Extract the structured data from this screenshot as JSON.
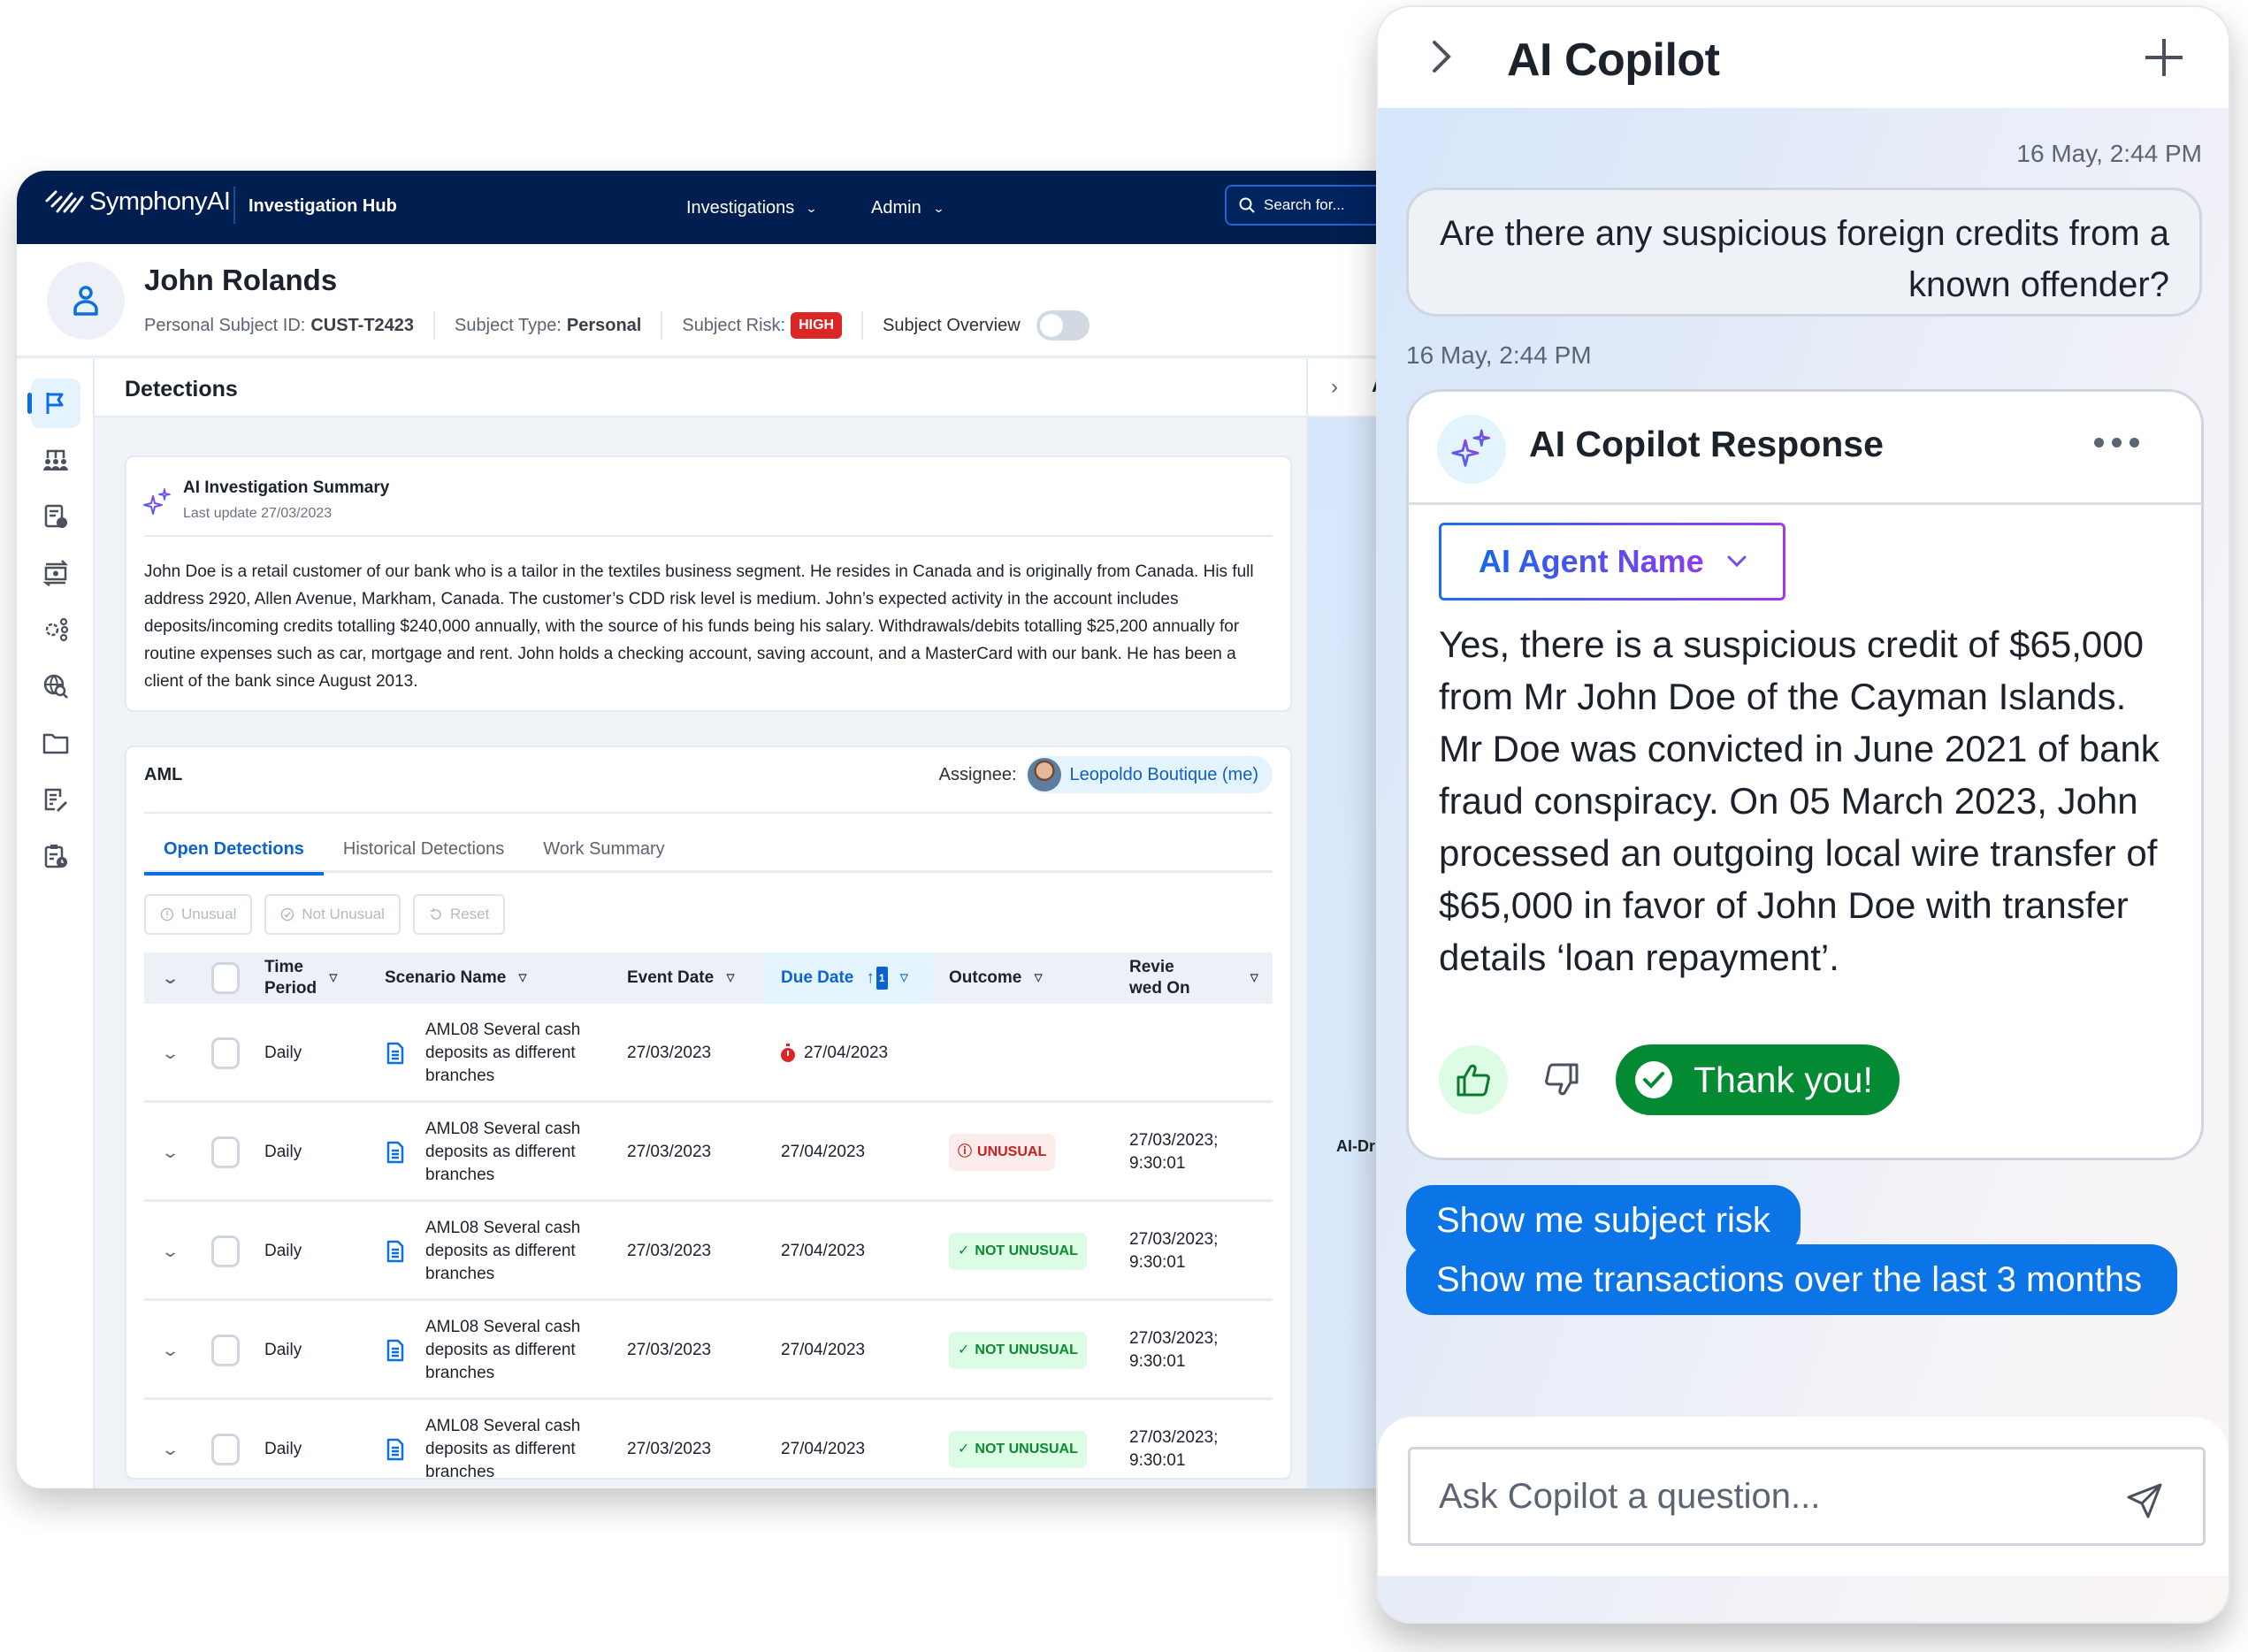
{
  "app": {
    "brand": "SymphonyAI",
    "product": "Investigation Hub",
    "nav": [
      {
        "label": "Investigations",
        "icon": "chevron-down-icon"
      },
      {
        "label": "Admin",
        "icon": "chevron-down-icon"
      }
    ],
    "search": {
      "placeholder": "Search for..."
    }
  },
  "subject": {
    "name": "John Rolands",
    "id_label": "Personal Subject ID:",
    "id_value": "CUST-T2423",
    "type_label": "Subject Type:",
    "type_value": "Personal",
    "risk_label": "Subject Risk:",
    "risk_value": "HIGH",
    "overview_label": "Subject Overview",
    "overview_on": false
  },
  "sidebar": {
    "items": [
      {
        "icon": "flag-icon",
        "active": true
      },
      {
        "icon": "org-people-icon"
      },
      {
        "icon": "document-info-icon"
      },
      {
        "icon": "money-transfer-icon"
      },
      {
        "icon": "network-gear-icon"
      },
      {
        "icon": "globe-search-icon"
      },
      {
        "icon": "folder-icon"
      },
      {
        "icon": "document-edit-icon"
      },
      {
        "icon": "clipboard-clock-icon"
      }
    ]
  },
  "detections": {
    "title": "Detections",
    "side_panel_letter": "A",
    "side_panel_label": "AI-Dr"
  },
  "summary": {
    "title": "AI Investigation Summary",
    "last_update": "Last update 27/03/2023",
    "text": "John Doe is a retail customer of our bank who is a tailor in the textiles business segment. He resides in Canada and is originally from Canada. His full address 2920, Allen Avenue, Markham, Canada. The customer’s CDD risk level is medium. John’s expected activity in the account includes deposits/incoming credits totalling $240,000 annually, with the source of his funds being his salary. Withdrawals/debits totalling $25,200 annually for routine expenses such as car, mortgage and rent. John holds a checking account, saving account, and a MasterCard with our bank. He has been a client of the bank since August 2013."
  },
  "aml": {
    "title": "AML",
    "assignee_label": "Assignee:",
    "assignee_name": "Leopoldo Boutique (me)",
    "tabs": [
      "Open Detections",
      "Historical Detections",
      "Work Summary"
    ],
    "active_tab": 0,
    "actions": [
      {
        "label": "Unusual",
        "icon": "alert-circle-icon"
      },
      {
        "label": "Not Unusual",
        "icon": "check-circle-icon"
      },
      {
        "label": "Reset",
        "icon": "reset-icon"
      }
    ],
    "columns": [
      "Time Period",
      "Scenario Name",
      "Event Date",
      "Due Date",
      "Outcome",
      "Reviewed On"
    ],
    "column_display": {
      "time_period": [
        "Time",
        "Period"
      ],
      "reviewed_on": [
        "Revie",
        "wed On"
      ]
    },
    "due_sort_index": "1",
    "rows": [
      {
        "period": "Daily",
        "scenario": "AML08 Several cash deposits as different branches",
        "event_date": "27/03/2023",
        "due_date": "27/04/2023",
        "overdue": true,
        "outcome": "",
        "reviewed_date": "",
        "reviewed_time": ""
      },
      {
        "period": "Daily",
        "scenario": "AML08 Several cash deposits as different branches",
        "event_date": "27/03/2023",
        "due_date": "27/04/2023",
        "overdue": false,
        "outcome": "UNUSUAL",
        "reviewed_date": "27/03/2023;",
        "reviewed_time": "9:30:01"
      },
      {
        "period": "Daily",
        "scenario": "AML08 Several cash deposits as different branches",
        "event_date": "27/03/2023",
        "due_date": "27/04/2023",
        "overdue": false,
        "outcome": "NOT UNUSUAL",
        "reviewed_date": "27/03/2023;",
        "reviewed_time": "9:30:01"
      },
      {
        "period": "Daily",
        "scenario": "AML08 Several cash deposits as different branches",
        "event_date": "27/03/2023",
        "due_date": "27/04/2023",
        "overdue": false,
        "outcome": "NOT UNUSUAL",
        "reviewed_date": "27/03/2023;",
        "reviewed_time": "9:30:01"
      },
      {
        "period": "Daily",
        "scenario": "AML08 Several cash deposits as different branches",
        "event_date": "27/03/2023",
        "due_date": "27/04/2023",
        "overdue": false,
        "outcome": "NOT UNUSUAL",
        "reviewed_date": "27/03/2023;",
        "reviewed_time": "9:30:01"
      }
    ]
  },
  "copilot": {
    "title": "AI Copilot",
    "user_time": "16 May, 2:44 PM",
    "user_message": "Are there any suspicious foreign credits from a known offender?",
    "response_time": "16 May, 2:44 PM",
    "response_title": "AI Copilot Response",
    "agent_name": "AI Agent Name",
    "response_text": "Yes, there is a suspicious credit of $65,000 from Mr John Doe of the Cayman Islands. Mr Doe was convicted in June 2021 of bank fraud conspiracy. On 05 March 2023, John processed an outgoing local wire transfer of $65,000 in favor of John Doe with transfer details ‘loan repayment’.",
    "feedback_thanks": "Thank you!",
    "suggestions": [
      "Show me subject risk",
      "Show me transactions over the last 3 months"
    ],
    "input_placeholder": "Ask Copilot a question..."
  },
  "colors": {
    "navy": "#001e4f",
    "primary": "#0b6fe3",
    "risk_high": "#dc2626",
    "success": "#058a34",
    "unusual_bg": "#fdecec",
    "not_unusual_bg": "#dcfce5"
  }
}
